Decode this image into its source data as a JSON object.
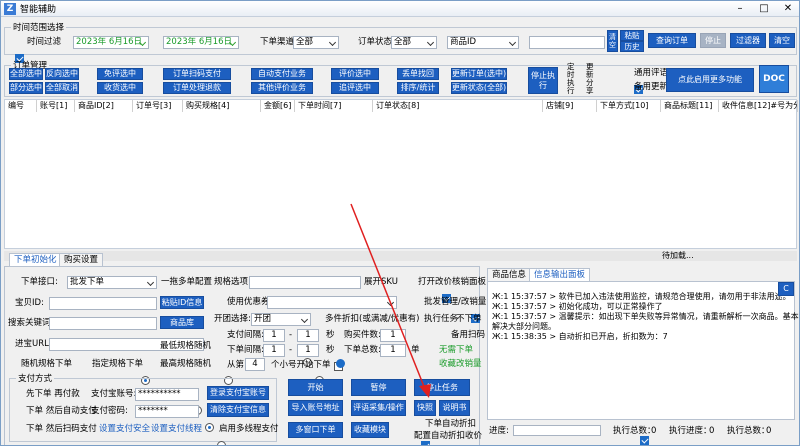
{
  "app": {
    "title": "智能辅助",
    "icon_letter": "Z"
  },
  "window_controls": {
    "minimize": "–",
    "maximize": "□",
    "close": "✕"
  },
  "time_range": {
    "legend": "时间范围选择",
    "time_filter": "时间过滤",
    "start_date": "2023年 6月16日",
    "end_date": "2023年 6月16日",
    "order_channel": "下单渠道",
    "order_channel_val": "全部",
    "order_status": "订单状态",
    "order_status_val": "全部",
    "product_type": "商品ID",
    "search_value": "",
    "clear": "清空",
    "paste": "粘贴",
    "history": "历史",
    "query": "查询订单",
    "stop": "停止",
    "filter": "过滤器",
    "clear2": "清空"
  },
  "order_mgmt": {
    "legend": "订单管理",
    "buttons": [
      "全部选中",
      "反向选中",
      "免评选中",
      "订单扫码支付",
      "自动支付业务",
      "评价选中",
      "丢单找回",
      "更新订单(选中)",
      "部分选中",
      "全部取消",
      "收货选中",
      "订单处理退款",
      "其他评价业务",
      "追评选中",
      "排序/统计",
      "更新状态(全部)"
    ],
    "stop_exec": "停止执行",
    "timed": "定时执行",
    "update_dl": "更新分享",
    "general_review": "通用评语",
    "backup_update": "备用更新",
    "enable_more": "点此启用更多功能",
    "doc": "DOC"
  },
  "table": {
    "columns": [
      "编号",
      "账号[1]",
      "商品ID[2]",
      "订单号[3]",
      "购买规格[4]",
      "金额[6]",
      "下单时间[7]",
      "订单状态[8]",
      "店铺[9]",
      "下单方式[10]",
      "商品标题[11]",
      "收件信息[12]#号为分隔"
    ]
  },
  "status": {
    "waiting": "待加载..."
  },
  "left_tabs": [
    "下单初始化",
    "购买设置"
  ],
  "settings": {
    "order_api": "下单接口:",
    "order_api_val": "批发下单",
    "one_to_many": "一拖多单配置",
    "spec_option": "规格选项:",
    "expand_sku": "展开SKU",
    "open_review_panel": "打开改价核销面板",
    "baby_id": "宝贝ID:",
    "paste_id_btn": "粘贴ID信息",
    "use_coupon": "使用优惠券",
    "batch_mgmt": "批发管理/改销量",
    "search_kw": "搜索关键词:",
    "product_lib": "商品库",
    "launch_select": "开团选择:",
    "launch_val": "开团",
    "multi_discount": "多件折扣(或满减/优惠有)",
    "exec_task": "执行任务",
    "no_order": "不下单",
    "entry_url": "进宝URL:",
    "backup_scan": "备用扫码",
    "pay_interval": "支付间隔:",
    "order_interval": "下单间隔:",
    "interval_a": "1",
    "interval_b": "1",
    "interval_c": "1",
    "interval_d": "1",
    "sec": "秒",
    "buy_qty": "购买件数:",
    "buy_qty_val": "1",
    "total_orders": "下单总数:",
    "total_orders_val": "1",
    "unit": "单",
    "no_task": "无需下单",
    "stock": "收藏改销量",
    "rand_spec": "随机规格下单",
    "fixed_spec": "指定规格下单",
    "min_spec": "最低规格随机",
    "max_spec": "最高规格随机",
    "start": "从第:",
    "start_val": "4",
    "small_order": "个小号开始下单"
  },
  "payment": {
    "legend": "支付方式",
    "first_pay": "先下单 再付款",
    "alipay_acct": "支付宝账号:",
    "alipay_acct_val": "**********",
    "then_pay": "下单 然后自动支付",
    "pay_pw": "支付密码:",
    "pay_pw_val": "*******",
    "scan_pay": "下单 然后扫码支付",
    "safe": "设置支付安全",
    "pay_thread": "设置支付线程",
    "login_alipay": "登录支付宝账号",
    "clear_alipay": "清除支付宝信息",
    "multi_thread": "启用多线程支付"
  },
  "actions": {
    "start": "开始",
    "pause": "暂停",
    "stop_task": "停止任务",
    "import_addr": "导入账号地址",
    "review_collect": "评语采集/操作",
    "quick": "快照",
    "manual": "说明书",
    "multi_window": "多窗口下单",
    "collect": "收藏模块",
    "auto_discount": "下单自动折扣",
    "config_discount": "配置自动折扣收价"
  },
  "right_tabs": [
    "商品信息",
    "信息输出面板"
  ],
  "log": [
    "Ж:1 15:37:57 > 软件已加入违法使用监控，请规范合理使用，请勿用于非法用途。",
    "Ж:1 15:37:57 > 初始化成功，可以正常操作了",
    "Ж:1 15:37:57 > 温馨提示：如出现下单失败等异常情况，请重新解析一次商品。基本上可",
    "解决大部分问题。",
    "Ж:1 15:38:35 > 自动折扣已开启，折扣数为：7"
  ],
  "log_btn": "C",
  "footer": {
    "progress": "进度:",
    "exec_total": "执行总数：",
    "exec_total_val": "0",
    "exec_progress": "执行进度：",
    "exec_progress_val": "0",
    "exec_num": "执行总数：",
    "exec_num_val": "0"
  }
}
